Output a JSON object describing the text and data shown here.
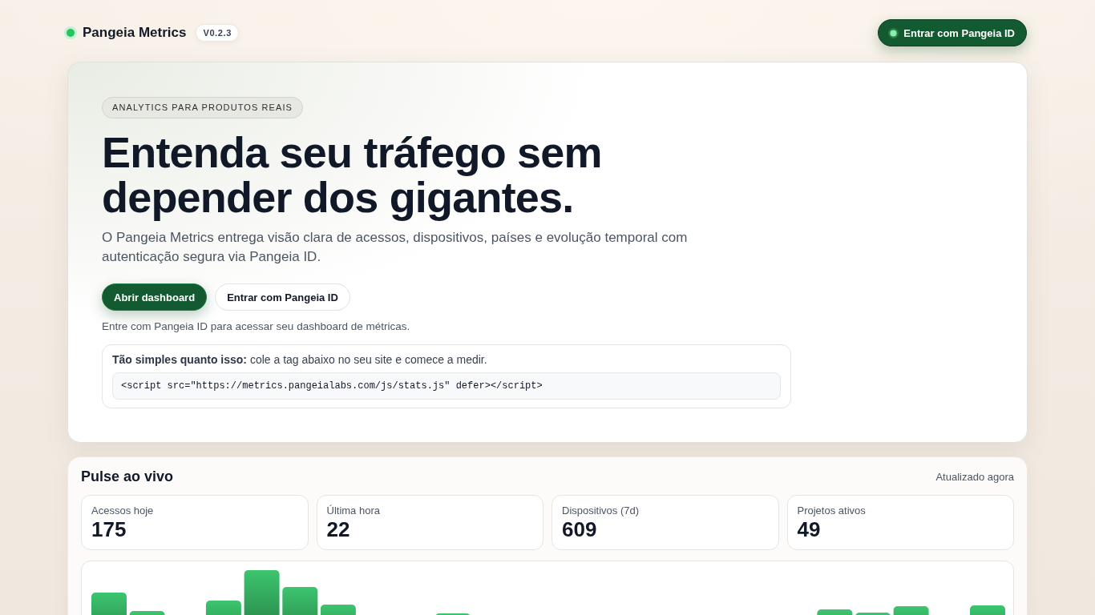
{
  "header": {
    "brand": "Pangeia Metrics",
    "version": "V0.2.3",
    "login_button": "Entrar com Pangeia ID"
  },
  "hero": {
    "eyebrow": "ANALYTICS PARA PRODUTOS REAIS",
    "title": "Entenda seu tráfego sem depender dos gigantes.",
    "description": "O Pangeia Metrics entrega visão clara de acessos, dispositivos, países e evolução temporal com autenticação segura via Pangeia ID.",
    "buttons": [
      {
        "label": "Abrir dashboard",
        "kind": "primary"
      },
      {
        "label": "Entrar com Pangeia ID",
        "kind": "secondary"
      }
    ],
    "note": "Entre com Pangeia ID para acessar seu dashboard de métricas.",
    "install": {
      "text": "**Tão simples quanto isso:** cole a tag abaixo no seu site e comece a medir.",
      "code": "<script src=\"https://metrics.pangeialabs.com/js/stats.js\" defer></script>"
    }
  },
  "pulse": {
    "title": "Pulse ao vivo",
    "updated": "Atualizado agora",
    "stats": [
      {
        "label": "Acessos hoje",
        "value": "175"
      },
      {
        "label": "Última hora",
        "value": "22"
      },
      {
        "label": "Dispositivos (7d)",
        "value": "609"
      },
      {
        "label": "Projetos ativos",
        "value": "49"
      }
    ]
  }
}
